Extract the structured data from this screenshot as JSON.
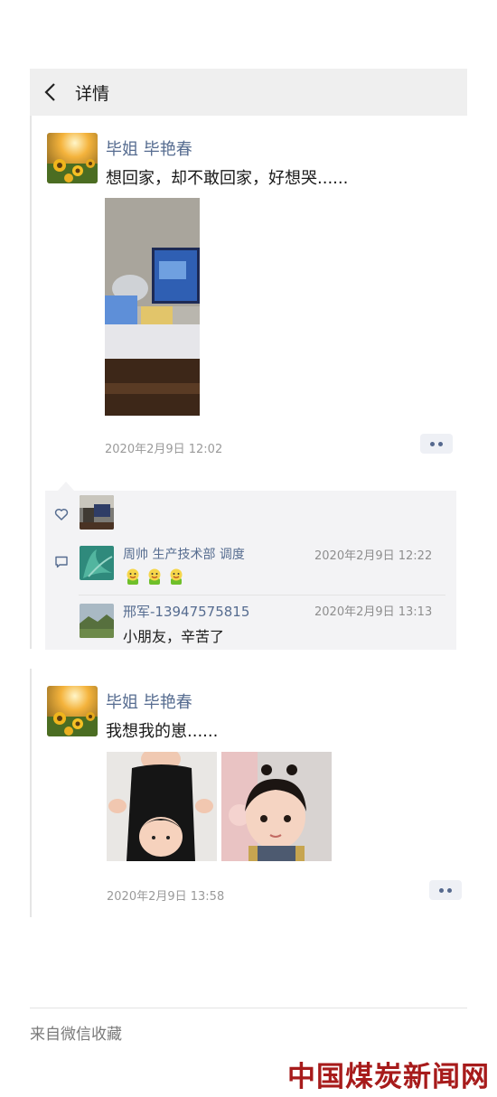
{
  "nav": {
    "title": "详情"
  },
  "posts": [
    {
      "author": "毕姐 毕艳春",
      "text": "想回家，却不敢回家，好想哭......",
      "time": "2020年2月9日 12:02",
      "comments": [
        {
          "name": "周帅 生产技术部 调度",
          "time": "2020年2月9日 12:22",
          "text": ""
        },
        {
          "name": "邢军-13947575815",
          "time": "2020年2月9日 13:13",
          "text": "小朋友，辛苦了"
        }
      ]
    },
    {
      "author": "毕姐 毕艳春",
      "text": "我想我的崽......",
      "time": "2020年2月9日 13:58"
    }
  ],
  "footer": {
    "source": "来自微信收藏"
  },
  "watermark": "中国煤炭新闻网",
  "colors": {
    "name_blue": "#566c90",
    "nav_bg": "#efefef",
    "panel_bg": "#f3f3f5",
    "watermark_red": "#a71b1b"
  }
}
